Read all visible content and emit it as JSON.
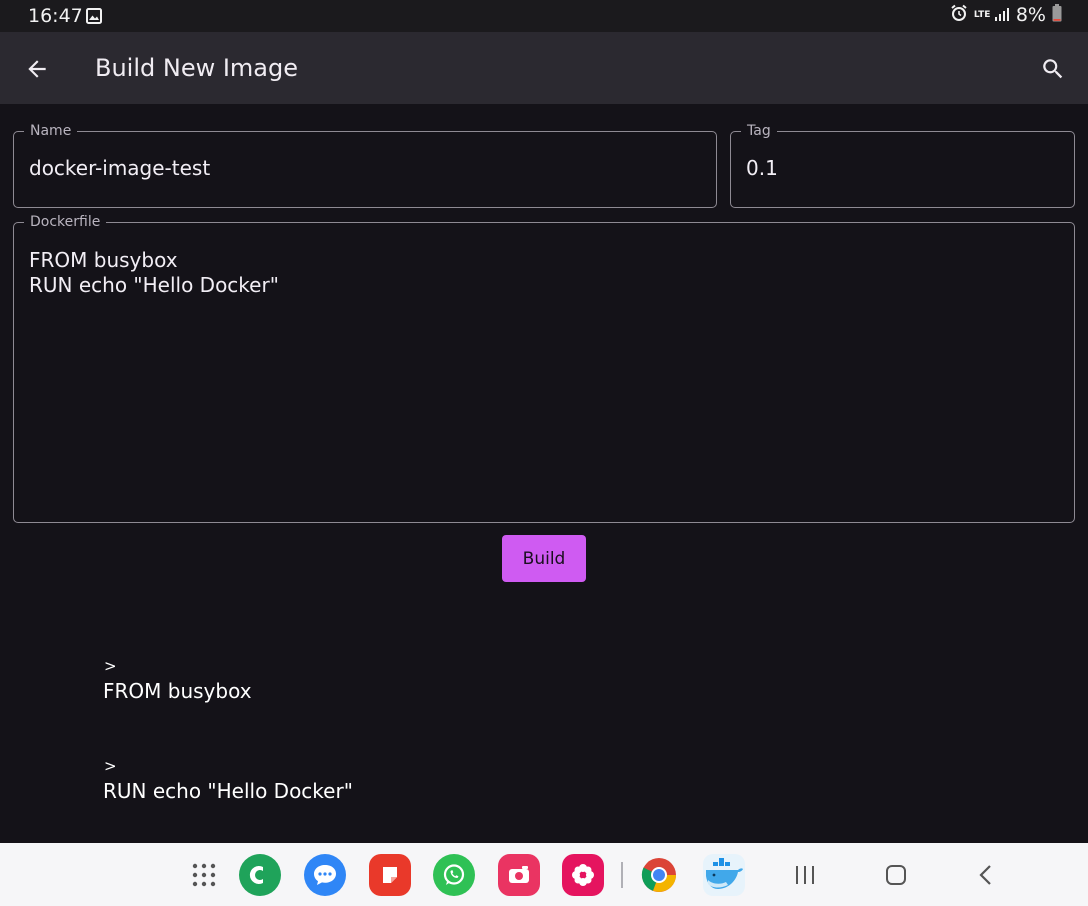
{
  "status_bar": {
    "time": "16:47",
    "network": "LTE",
    "battery": "8%"
  },
  "app_bar": {
    "title": "Build New Image"
  },
  "form": {
    "name_label": "Name",
    "name_value": "docker-image-test",
    "tag_label": "Tag",
    "tag_value": "0.1",
    "dockerfile_label": "Dockerfile",
    "dockerfile_lines": [
      "FROM busybox",
      "RUN echo \"Hello Docker\""
    ]
  },
  "build_button_label": "Build",
  "output_log": [
    {
      "prompt": ">",
      "text": "FROM busybox"
    },
    {
      "prompt": ">",
      "text": "RUN echo \"Hello Docker\""
    }
  ],
  "dock": {
    "apps": [
      "phone-icon",
      "messages-icon",
      "notes-icon",
      "whatsapp-icon",
      "camera-icon",
      "flower-app-icon",
      "chrome-icon",
      "docker-icon"
    ],
    "colors": {
      "phone": "#1fa35a",
      "messages": "#2f86f6",
      "notes": "#e9392a",
      "whatsapp": "#2fc155",
      "camera": "#ea3462",
      "flower": "#e5145f"
    }
  },
  "theme": {
    "background": "#141218",
    "app_bar": "#2b2930",
    "accent": "#cf5bf2"
  }
}
